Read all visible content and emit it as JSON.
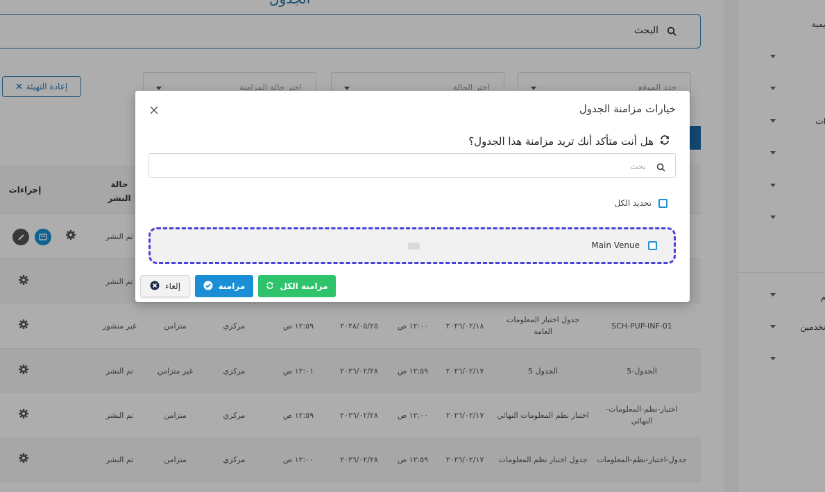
{
  "page": {
    "title_fragment": "الجدول",
    "search_label": "البحث",
    "reset_label": "إعادة التهيئة",
    "filters": [
      {
        "placeholder": "حدد الموقع"
      },
      {
        "placeholder": "اختر الحالة"
      },
      {
        "placeholder": "اختر حالة المزامنة"
      }
    ]
  },
  "sidebar": {
    "items": [
      "يمية",
      "ات",
      "م",
      "تخدمين"
    ]
  },
  "table": {
    "headers": {
      "actions": "إجراءات",
      "publish_status": "حالة النشر"
    },
    "rows": [
      {
        "code": "",
        "name": "",
        "date1": "",
        "time1": "",
        "date2": "",
        "time2": "",
        "location": "",
        "sync": "",
        "publish": "تم النشر"
      },
      {
        "code": "",
        "name": "",
        "date1": "",
        "time1": "",
        "date2": "",
        "time2": "",
        "location": "",
        "sync": "",
        "publish": "تم النشر"
      },
      {
        "code": "SCH-PUP-INF-01",
        "name": "جدول اختبار المعلومات العامة",
        "date1": "٢٠٢٦/٠٢/١٨",
        "time1": "١٢:٠٠ ص",
        "date2": "٢٠٢٨/٠٥/٢٥",
        "time2": "١٢:٥٩ ص",
        "location": "مركزي",
        "sync": "متزامن",
        "publish": "غير منشور"
      },
      {
        "code": "الجدول-5",
        "name": "الجدول 5",
        "date1": "٢٠٢٦/٠٢/١٧",
        "time1": "١٢:٥٩ ص",
        "date2": "٢٠٢٦/٠٢/٢٨",
        "time2": "١٢:٠١ ص",
        "location": "مركزي",
        "sync": "غير متزامن",
        "publish": "تم النشر"
      },
      {
        "code": "اختبار-نظم-المعلومات-النهائي",
        "name": "اختبار نظم المعلومات النهائي",
        "date1": "٢٠٢٦/٠٢/١٧",
        "time1": "١٢:٠٠ ص",
        "date2": "٢٠٢٦/٠٢/٢٨",
        "time2": "١٢:٥٩ ص",
        "location": "مركزي",
        "sync": "متزامن",
        "publish": "تم النشر"
      },
      {
        "code": "جدول-اختبار-نظم-المعلومات",
        "name": "جدول اختبار نظم المعلومات",
        "date1": "٢٠٢٦/٠٢/١٧",
        "time1": "١٢:٥٩ ص",
        "date2": "٢٠٢٦/٠٢/٢٨",
        "time2": "١٢:٠٠ ص",
        "location": "مركزي",
        "sync": "متزامن",
        "publish": "تم النشر"
      }
    ]
  },
  "dialog": {
    "title": "خيارات مزامنة الجدول",
    "question": "هل أنت متأكد أنك تريد مزامنة هذا الجدول؟",
    "search_placeholder": "بحث",
    "select_all_label": "تحديد الكل",
    "venue_label": "Main Venue",
    "buttons": {
      "sync_all": "مزامنة الكل",
      "sync": "مزامنة",
      "cancel": "إلغاء"
    }
  },
  "colors": {
    "primary": "#2c7cb3",
    "success": "#2fc36b",
    "info": "#1a8fd6",
    "highlight_border": "#4a3fd9"
  }
}
